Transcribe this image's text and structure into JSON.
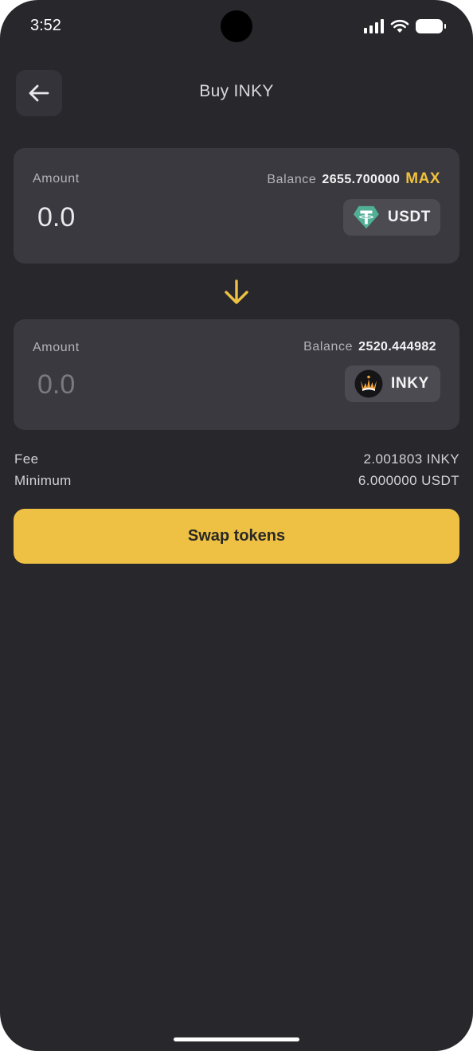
{
  "status_bar": {
    "time": "3:52"
  },
  "header": {
    "title": "Buy INKY"
  },
  "from": {
    "amount_label": "Amount",
    "balance_label": "Balance",
    "balance_value": "2655.700000",
    "max_label": "MAX",
    "amount_value": "0.0",
    "token": "USDT",
    "token_icon": "tether-icon",
    "token_color": "#50af95"
  },
  "to": {
    "amount_label": "Amount",
    "balance_label": "Balance",
    "balance_value": "2520.444982",
    "amount_value": "0.0",
    "token": "INKY",
    "token_icon": "inky-crown-icon"
  },
  "fees": [
    {
      "label": "Fee",
      "value": "2.001803 INKY"
    },
    {
      "label": "Minimum",
      "value": "6.000000 USDT"
    }
  ],
  "actions": {
    "swap_label": "Swap tokens"
  },
  "colors": {
    "accent": "#eec144",
    "background": "#28272c",
    "card": "#3a393f"
  }
}
